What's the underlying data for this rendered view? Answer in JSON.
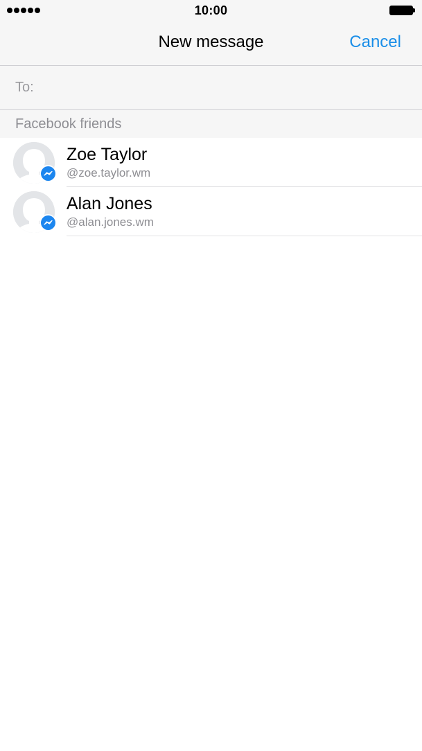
{
  "status_bar": {
    "signal_dots": 5,
    "time": "10:00",
    "battery_icon": "battery-full-icon"
  },
  "nav": {
    "title": "New message",
    "cancel_label": "Cancel",
    "accent_color": "#1a8ee8"
  },
  "to_field": {
    "label": "To:",
    "value": "",
    "placeholder": ""
  },
  "section": {
    "title": "Facebook friends"
  },
  "friends": [
    {
      "name": "Zoe Taylor",
      "handle": "@zoe.taylor.wm",
      "avatar_icon": "default-avatar-icon",
      "badge_icon": "messenger-badge-icon"
    },
    {
      "name": "Alan Jones",
      "handle": "@alan.jones.wm",
      "avatar_icon": "default-avatar-icon",
      "badge_icon": "messenger-badge-icon"
    }
  ]
}
